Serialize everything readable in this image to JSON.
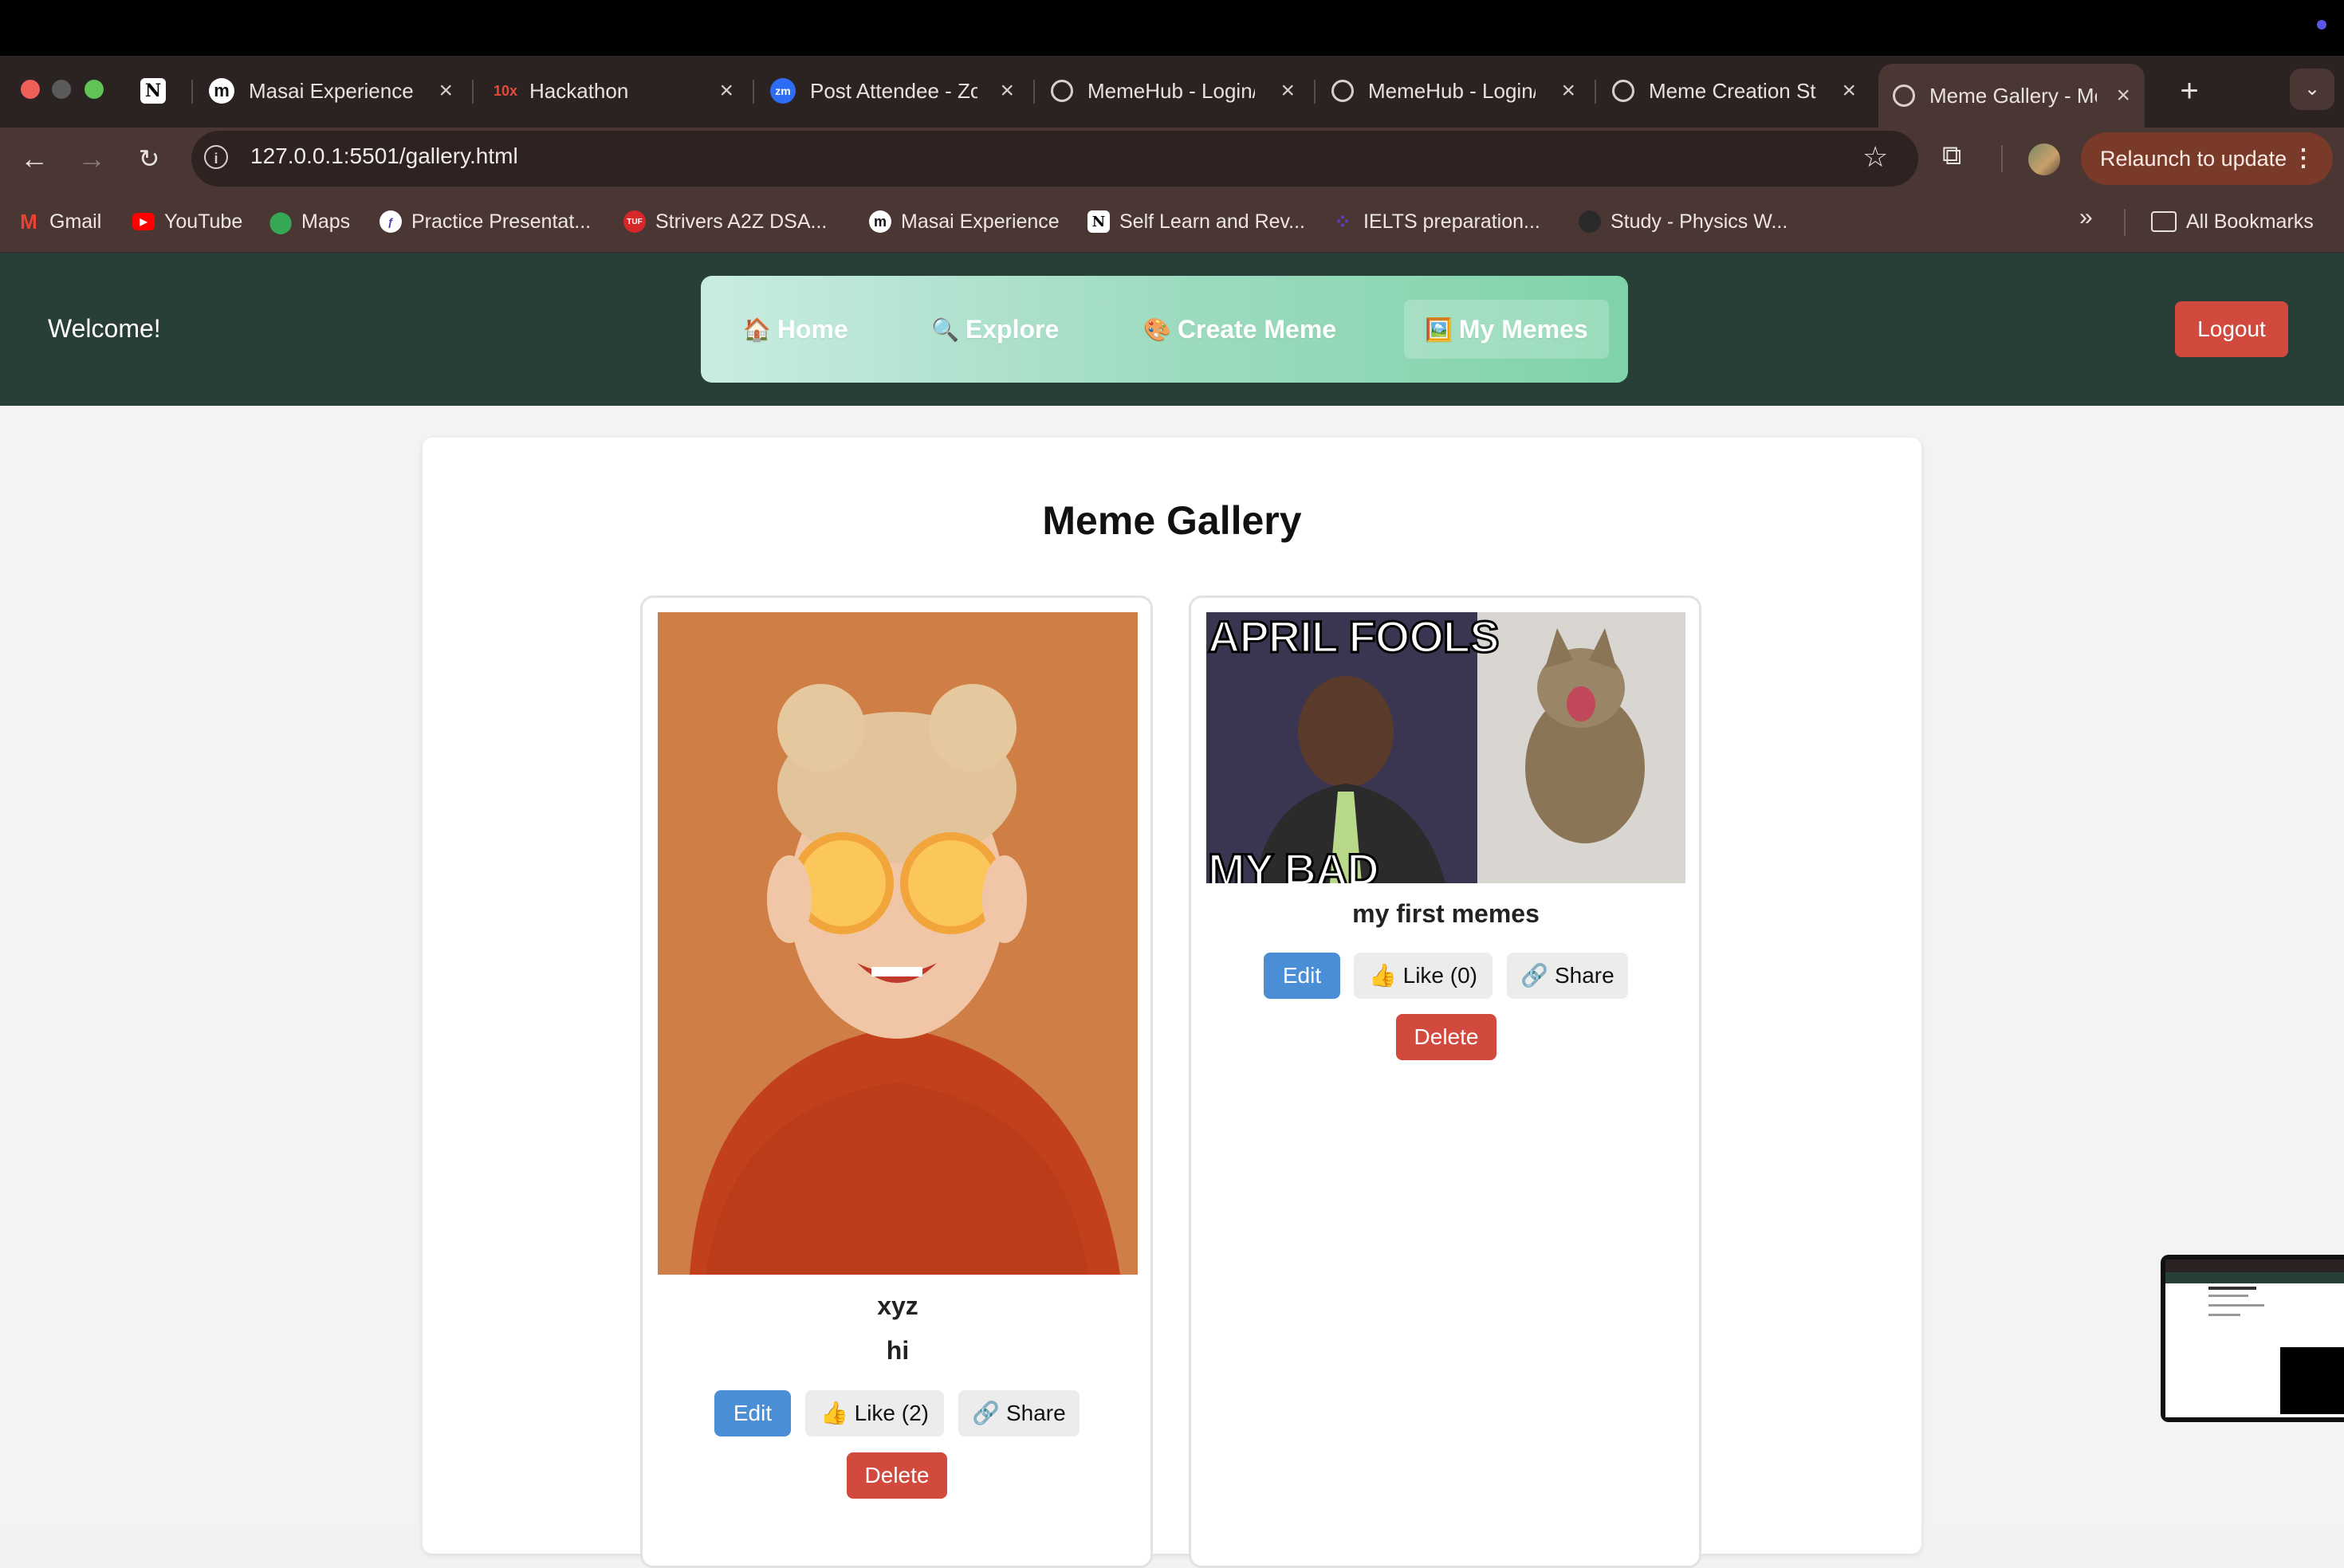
{
  "browser": {
    "tabs": [
      {
        "title": "",
        "favicon": "N"
      },
      {
        "title": "Masai Experience",
        "favicon": "m"
      },
      {
        "title": "Hackathon",
        "favicon": "10x"
      },
      {
        "title": "Post Attendee - Zo",
        "favicon": "zm"
      },
      {
        "title": "MemeHub - Login/",
        "favicon": "globe"
      },
      {
        "title": "MemeHub - Login/",
        "favicon": "globe"
      },
      {
        "title": "Meme Creation St",
        "favicon": "globe"
      },
      {
        "title": "Meme Gallery - Me",
        "favicon": "globe",
        "active": true
      }
    ],
    "new_tab": "+",
    "url": "127.0.0.1:5501/gallery.html",
    "relaunch_label": "Relaunch to update",
    "bookmarks": [
      {
        "label": "Gmail",
        "icon": "gmail-icon"
      },
      {
        "label": "YouTube",
        "icon": "youtube-icon"
      },
      {
        "label": "Maps",
        "icon": "maps-icon"
      },
      {
        "label": "Practice Presentat...",
        "icon": "practice-icon"
      },
      {
        "label": "Strivers A2Z DSA...",
        "icon": "tuf-icon"
      },
      {
        "label": "Masai Experience",
        "icon": "masai-icon"
      },
      {
        "label": "Self Learn and Rev...",
        "icon": "notion-icon"
      },
      {
        "label": "IELTS preparation...",
        "icon": "ielts-icon"
      },
      {
        "label": "Study - Physics W...",
        "icon": "study-icon"
      }
    ],
    "more_bookmarks": "»",
    "all_bookmarks_label": "All Bookmarks"
  },
  "app": {
    "welcome": "Welcome!",
    "nav": [
      {
        "icon": "🏠",
        "label": "Home"
      },
      {
        "icon": "🔍",
        "label": "Explore"
      },
      {
        "icon": "🎨",
        "label": "Create Meme"
      },
      {
        "icon": "🖼️",
        "label": "My Memes",
        "active": true
      }
    ],
    "logout_label": "Logout",
    "page_title": "Meme Gallery",
    "memes": [
      {
        "title": "xyz",
        "subtitle": "hi",
        "edit_label": "Edit",
        "like_label": "👍 Like (2)",
        "share_label": "🔗 Share",
        "delete_label": "Delete"
      },
      {
        "title": "my first memes",
        "top_text": "APRIL FOOLS",
        "bottom_text": "MY BAD",
        "edit_label": "Edit",
        "like_label": "👍 Like (0)",
        "share_label": "🔗 Share",
        "delete_label": "Delete"
      }
    ]
  },
  "colors": {
    "header_bg": "#283f38",
    "nav_gradient_start": "#c9ece2",
    "nav_gradient_end": "#7fd3a8",
    "edit_button": "#4a8fd6",
    "delete_button": "#d24a3e",
    "tab_strip": "#2b2321",
    "toolbar": "#4a3632"
  }
}
